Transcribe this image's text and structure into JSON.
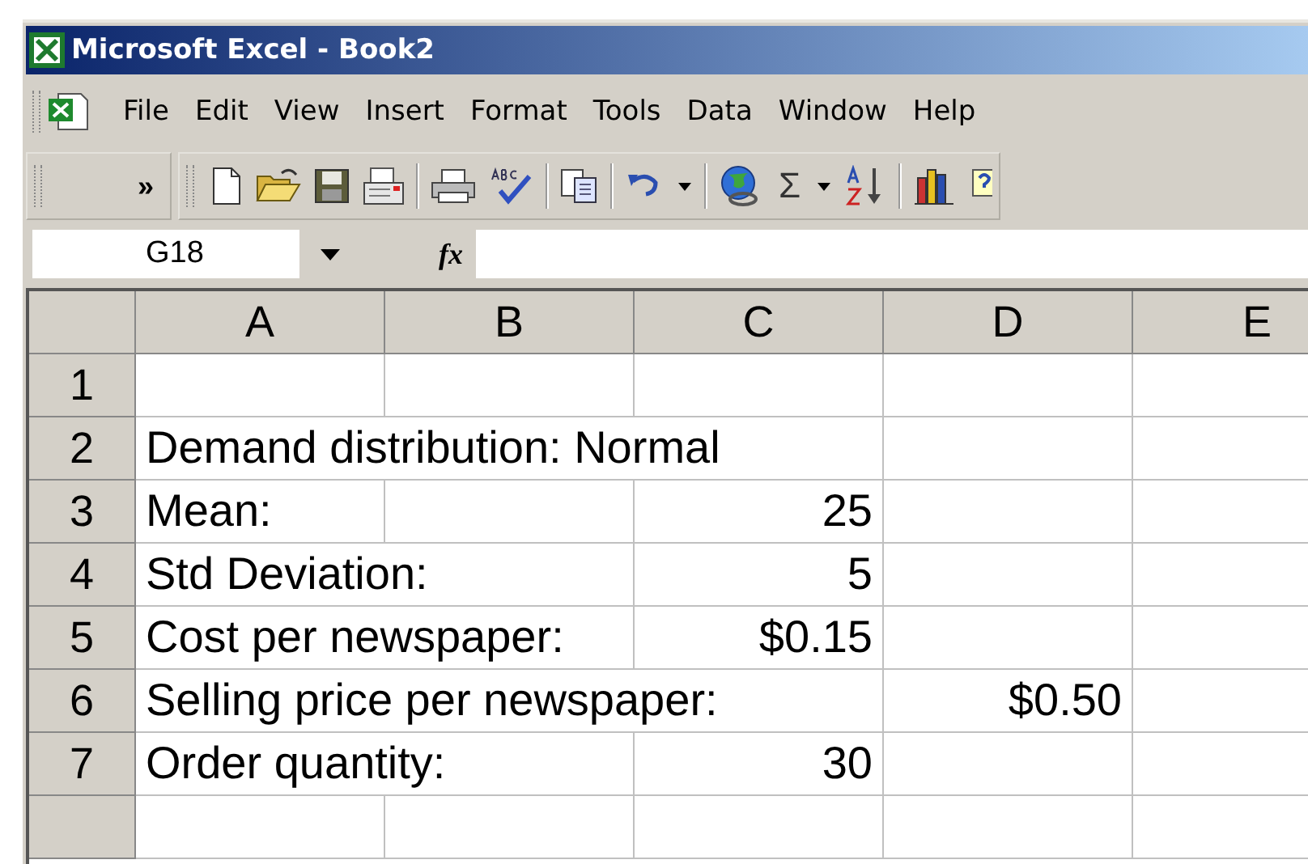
{
  "window": {
    "title": "Microsoft Excel - Book2"
  },
  "menu": [
    {
      "label": "File"
    },
    {
      "label": "Edit"
    },
    {
      "label": "View"
    },
    {
      "label": "Insert"
    },
    {
      "label": "Format"
    },
    {
      "label": "Tools"
    },
    {
      "label": "Data"
    },
    {
      "label": "Window"
    },
    {
      "label": "Help"
    }
  ],
  "toolbar": {
    "overflow": "»",
    "sum": "Σ"
  },
  "formula_bar": {
    "name_box": "G18",
    "fx": "fx"
  },
  "columns": [
    "A",
    "B",
    "C",
    "D",
    "E"
  ],
  "rows": [
    {
      "number": "1",
      "cells": {}
    },
    {
      "number": "2",
      "cells": {
        "A": {
          "text": "Demand distribution: Normal",
          "kind": "text"
        }
      }
    },
    {
      "number": "3",
      "cells": {
        "A": {
          "text": "Mean:",
          "kind": "text"
        },
        "C": {
          "text": "25",
          "kind": "number"
        }
      }
    },
    {
      "number": "4",
      "cells": {
        "A": {
          "text": "Std Deviation:",
          "kind": "text"
        },
        "C": {
          "text": "5",
          "kind": "number"
        }
      }
    },
    {
      "number": "5",
      "cells": {
        "A": {
          "text": "Cost per newspaper:",
          "kind": "text"
        },
        "C": {
          "text": "$0.15",
          "kind": "number"
        }
      }
    },
    {
      "number": "6",
      "cells": {
        "A": {
          "text": "Selling price per newspaper:",
          "kind": "text"
        },
        "D": {
          "text": "$0.50",
          "kind": "number"
        }
      }
    },
    {
      "number": "7",
      "cells": {
        "A": {
          "text": "Order quantity:",
          "kind": "text"
        },
        "C": {
          "text": "30",
          "kind": "number"
        }
      }
    }
  ]
}
